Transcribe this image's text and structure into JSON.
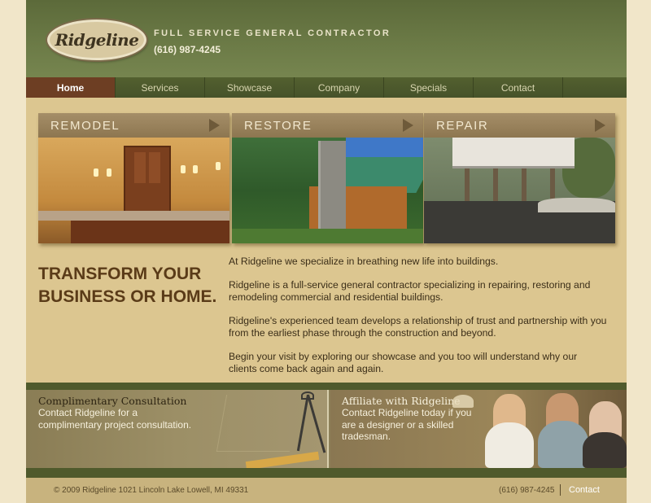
{
  "header": {
    "logo_text": "Ridgeline",
    "tagline": "FULL SERVICE GENERAL CONTRACTOR",
    "phone": "(616) 987-4245"
  },
  "nav": {
    "items": [
      {
        "label": "Home",
        "active": true
      },
      {
        "label": "Services",
        "active": false
      },
      {
        "label": "Showcase",
        "active": false
      },
      {
        "label": "Company",
        "active": false
      },
      {
        "label": "Specials",
        "active": false
      },
      {
        "label": "Contact",
        "active": false
      }
    ]
  },
  "panels": [
    {
      "title": "REMODEL",
      "icon": "arrow-right-icon"
    },
    {
      "title": "RESTORE",
      "icon": "arrow-right-icon"
    },
    {
      "title": "REPAIR",
      "icon": "arrow-right-icon"
    }
  ],
  "main": {
    "headline_line1": "TRANSFORM YOUR",
    "headline_line2": "BUSINESS OR HOME.",
    "paragraphs": [
      "At Ridgeline we specialize in breathing new life into buildings.",
      "Ridgeline is a full-service general contractor specializing in repairing, restoring and remodeling commercial and residential buildings.",
      "Ridgeline's experienced team develops a relationship of trust and partnership with you from the earliest phase through the construction and beyond.",
      "Begin your visit by exploring our showcase and you too will understand why our clients come back again and again."
    ]
  },
  "consult": {
    "title": "Complimentary Consultation",
    "text": "Contact Ridgeline for a complimentary project consultation."
  },
  "affiliate": {
    "title": "Affiliate with Ridgeline",
    "text": "Contact Ridgeline today if you are a designer or a skilled tradesman."
  },
  "footer": {
    "copyright": "© 2009 Ridgeline 1021 Lincoln Lake Lowell, MI 49331",
    "phone": "(616) 987-4245",
    "contact": "Contact"
  },
  "colors": {
    "header_green": "#6b7a46",
    "nav_active": "#6d3e23",
    "page_tan": "#dcc690",
    "headline_brown": "#5a3b18"
  }
}
